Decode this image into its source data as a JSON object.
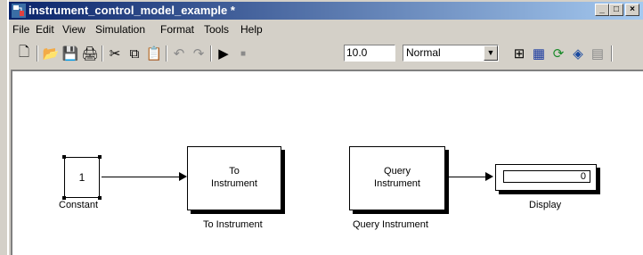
{
  "window": {
    "title": "instrument_control_model_example *"
  },
  "window_buttons": {
    "minimize": "_",
    "maximize": "□",
    "close": "×"
  },
  "menu": [
    "File",
    "Edit",
    "View",
    "Simulation",
    "Format",
    "Tools",
    "Help"
  ],
  "toolbar": {
    "icons": [
      "new-icon",
      "open-icon",
      "save-icon",
      "print-icon",
      "cut-icon",
      "copy-icon",
      "paste-icon",
      "undo-icon",
      "redo-icon",
      "play-icon",
      "stop-icon",
      "build-icon",
      "update-icon",
      "refresh-icon",
      "library-icon",
      "explorer-icon"
    ],
    "stop_time": "10.0",
    "sim_mode": "Normal"
  },
  "blocks": {
    "constant": {
      "value": "1",
      "label": "Constant"
    },
    "to_instrument": {
      "inner": [
        "To",
        "Instrument"
      ],
      "label": "To Instrument"
    },
    "query_instrument": {
      "inner": [
        "Query",
        "Instrument"
      ],
      "label": "Query Instrument"
    },
    "display": {
      "value": "0",
      "label": "Display"
    }
  }
}
